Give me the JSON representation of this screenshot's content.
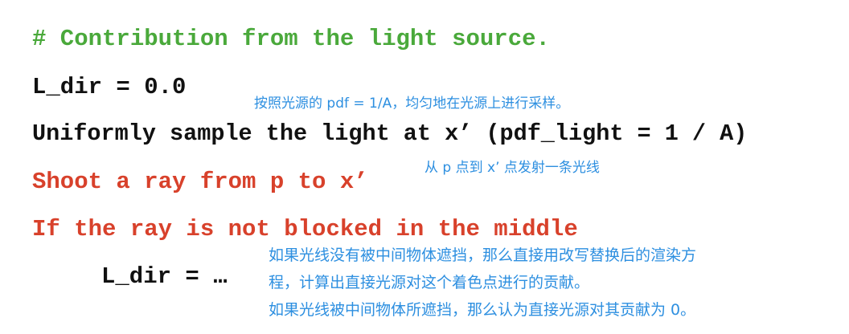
{
  "code": {
    "comment": "# Contribution from the light source.",
    "line_l_dir_init": "L_dir = 0.0",
    "line_uniform_sample": "Uniformly sample the light at x’ (pdf_light = 1 / A)",
    "line_shoot_ray": "Shoot a ray from p to x’",
    "line_if_prefix": "If the ray is not blocked ",
    "line_if_emphasis": "in the middle",
    "line_l_dir_assign": "L_dir = …"
  },
  "annotations": {
    "sample_note": "按照光源的 pdf = 1/A，均匀地在光源上进行采样。",
    "shoot_note": "从 p 点到 x’ 点发射一条光线",
    "blocked_note_line1": "如果光线没有被中间物体遮挡，那么直接用改写替换后的渲染方",
    "blocked_note_line2": "程，计算出直接光源对这个着色点进行的贡献。",
    "blocked_note_line3": "如果光线被中间物体所遮挡，那么认为直接光源对其贡献为 0。"
  },
  "colors": {
    "comment": "#4aa93b",
    "code": "#111111",
    "highlight": "#d8412b",
    "annotation": "#2d8fe0"
  }
}
